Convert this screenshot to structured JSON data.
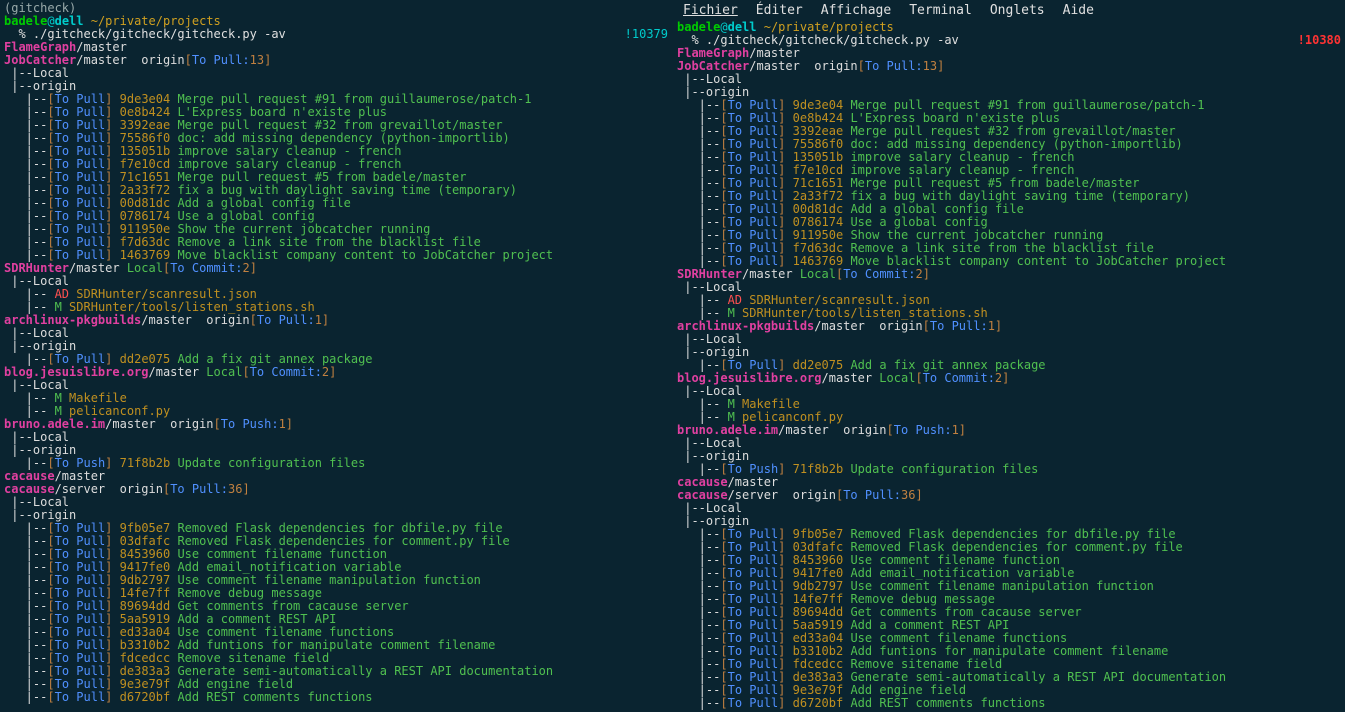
{
  "menubar": [
    "Fichier",
    "Éditer",
    "Affichage",
    "Terminal",
    "Onglets",
    "Aide"
  ],
  "header": {
    "gitcheck_label": "(gitcheck)",
    "user": "badele",
    "at": "@",
    "host": "dell",
    "path": " ~/private/projects",
    "prompt": "  % ",
    "command": "./gitcheck/gitcheck/gitcheck.py -av",
    "hist_left": "!10379",
    "hist_right": "!10380"
  },
  "repos": [
    {
      "name": "FlameGraph",
      "branch": "/master"
    },
    {
      "name": "JobCatcher",
      "branch": "/master",
      "remote": "  origin",
      "status_label": "To Pull:",
      "status_num": "13",
      "local": true,
      "origin": true,
      "commits": [
        {
          "hash": "9de3e04",
          "msg": "Merge pull request #91 from guillaumerose/patch-1"
        },
        {
          "hash": "0e8b424",
          "msg": "L'Express board n'existe plus"
        },
        {
          "hash": "3392eae",
          "msg": "Merge pull request #32 from grevaillot/master"
        },
        {
          "hash": "75586f0",
          "msg": "doc: add missing dependency (python-importlib)"
        },
        {
          "hash": "135051b",
          "msg": "improve salary cleanup - french"
        },
        {
          "hash": "f7e10cd",
          "msg": "improve salary cleanup - french"
        },
        {
          "hash": "71c1651",
          "msg": "Merge pull request #5 from badele/master"
        },
        {
          "hash": "2a33f72",
          "msg": "fix a bug with daylight saving time (temporary)"
        },
        {
          "hash": "00d81dc",
          "msg": "Add a global config file"
        },
        {
          "hash": "0786174",
          "msg": "Use a global config"
        },
        {
          "hash": "911950e",
          "msg": "Show the current jobcatcher running"
        },
        {
          "hash": "f7d63dc",
          "msg": "Remove a link site from the blacklist file"
        },
        {
          "hash": "1463769",
          "msg": "Move blacklist company content to JobCatcher project"
        }
      ]
    },
    {
      "name": "SDRHunter",
      "branch": "/master",
      "local_remote": " Local",
      "status_label": "To Commit:",
      "status_num": "2",
      "local": true,
      "files": [
        {
          "flag": "AD",
          "path": "SDRHunter/scanresult.json"
        },
        {
          "flag": "M",
          "path": "SDRHunter/tools/listen_stations.sh"
        }
      ]
    },
    {
      "name": "archlinux-pkgbuilds",
      "branch": "/master",
      "remote": "  origin",
      "status_label": "To Pull:",
      "status_num": "1",
      "local": true,
      "origin": true,
      "commits": [
        {
          "hash": "dd2e075",
          "msg": "Add a fix git annex package"
        }
      ]
    },
    {
      "name": "blog.jesuislibre.org",
      "branch": "/master",
      "local_remote": " Local",
      "status_label": "To Commit:",
      "status_num": "2",
      "local": true,
      "files": [
        {
          "flag": "M",
          "path": "Makefile"
        },
        {
          "flag": "M",
          "path": "pelicanconf.py"
        }
      ]
    },
    {
      "name": "bruno.adele.im",
      "branch": "/master",
      "remote": "  origin",
      "status_label": "To Push:",
      "status_num": "1",
      "local": true,
      "origin": true,
      "commits_push": [
        {
          "hash": "71f8b2b",
          "msg": "Update configuration files"
        }
      ]
    },
    {
      "name": "cacause",
      "branch": "/master"
    },
    {
      "name": "cacause",
      "branch": "/server",
      "remote": "  origin",
      "status_label": "To Pull:",
      "status_num": "36",
      "local": true,
      "origin": true,
      "commits": [
        {
          "hash": "9fb05e7",
          "msg": "Removed Flask dependencies for dbfile.py file"
        },
        {
          "hash": "03dfafc",
          "msg": "Removed Flask dependencies for comment.py file"
        },
        {
          "hash": "8453960",
          "msg": "Use comment filename function"
        },
        {
          "hash": "9417fe0",
          "msg": "Add email_notification variable"
        },
        {
          "hash": "9db2797",
          "msg": "Use comment filename manipulation function"
        },
        {
          "hash": "14fe7ff",
          "msg": "Remove debug message"
        },
        {
          "hash": "89694dd",
          "msg": "Get comments from cacause server"
        },
        {
          "hash": "5aa5919",
          "msg": "Add a comment REST API"
        },
        {
          "hash": "ed33a04",
          "msg": "Use comment filename functions"
        },
        {
          "hash": "b3310b2",
          "msg": "Add funtions for manipulate comment filename"
        },
        {
          "hash": "fdcedcc",
          "msg": "Remove sitename field"
        },
        {
          "hash": "de383a3",
          "msg": "Generate semi-automatically a REST API documentation"
        },
        {
          "hash": "9e3e79f",
          "msg": "Add engine field"
        },
        {
          "hash": "d6720bf",
          "msg": "Add REST comments functions"
        }
      ]
    }
  ],
  "labels": {
    "local": "|--Local",
    "origin": "|--origin",
    "to_pull": "[To Pull]",
    "to_push": "[To Push]",
    "tree_commit": "   |--"
  }
}
